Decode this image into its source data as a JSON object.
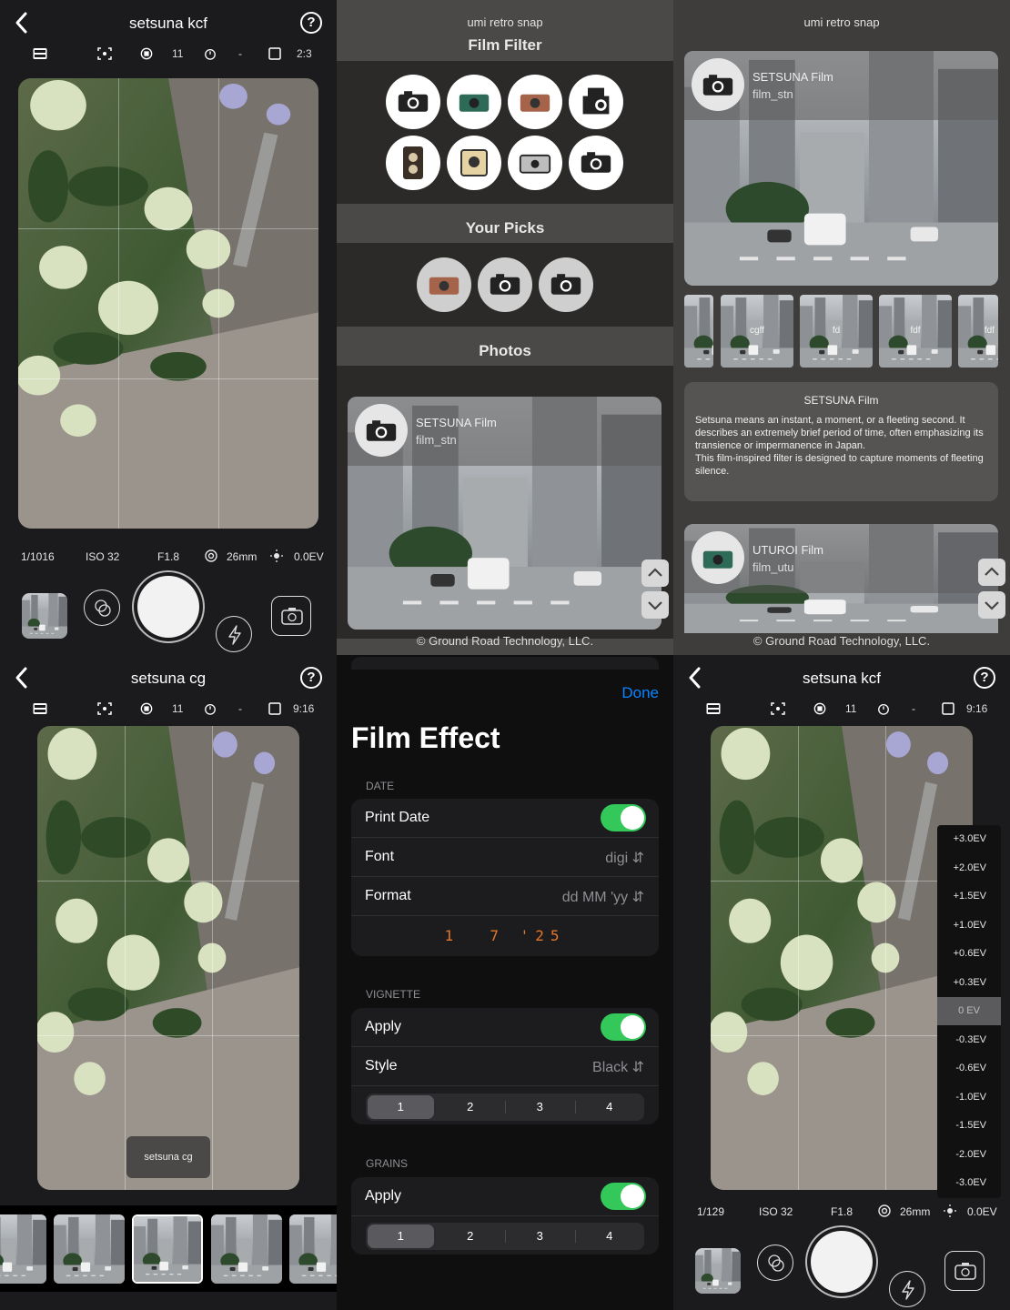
{
  "camera_kcf_1": {
    "title": "setsuna kcf",
    "toolbar": {
      "count": "11",
      "dash": "-",
      "ratio": "2:3"
    },
    "readouts": {
      "shutter": "1/1016",
      "iso": "ISO 32",
      "aperture": "F1.8",
      "focal": "26mm",
      "ev": "0.0EV"
    }
  },
  "film_filter": {
    "app_name": "umi retro snap",
    "heading": "Film Filter",
    "your_picks": "Your Picks",
    "photos": "Photos",
    "card": {
      "name": "SETSUNA Film",
      "code": "film_stn"
    },
    "footer": "Ground Road Technology, LLC."
  },
  "film_detail": {
    "app_name": "umi retro snap",
    "card": {
      "name": "SETSUNA Film",
      "code": "film_stn"
    },
    "strip_labels": [
      "",
      "cgff",
      "fd",
      "fdf",
      "fdf"
    ],
    "desc_title": "SETSUNA Film",
    "desc_body": "Setsuna means an instant, a moment, or a fleeting second. It describes an extremely brief period of time, often emphasizing its transience or impermanence in Japan.\nThis film-inspired filter is designed to capture moments of fleeting silence.",
    "card2": {
      "name": "UTUROI Film",
      "code": "film_utu"
    },
    "footer": "Ground Road Technology, LLC."
  },
  "camera_cg": {
    "title": "setsuna cg",
    "toolbar": {
      "count": "11",
      "dash": "-",
      "ratio": "9:16"
    },
    "overlay_label": "setsuna cg"
  },
  "film_effect": {
    "done": "Done",
    "heading": "Film Effect",
    "date_section": "DATE",
    "print_date": "Print Date",
    "font_label": "Font",
    "font_value": "digi",
    "format_label": "Format",
    "format_value": "dd MM 'yy",
    "date_preview": "1  7 '25",
    "vignette_section": "VIGNETTE",
    "apply": "Apply",
    "style_label": "Style",
    "style_value": "Black",
    "segments": [
      "1",
      "2",
      "3",
      "4"
    ],
    "grains_section": "GRAINS",
    "grains_apply": "Apply"
  },
  "camera_kcf_2": {
    "title": "setsuna kcf",
    "toolbar": {
      "count": "11",
      "dash": "-",
      "ratio": "9:16"
    },
    "ev_scale": [
      "+3.0EV",
      "+2.0EV",
      "+1.5EV",
      "+1.0EV",
      "+0.6EV",
      "+0.3EV",
      "0 EV",
      "-0.3EV",
      "-0.6EV",
      "-1.0EV",
      "-1.5EV",
      "-2.0EV",
      "-3.0EV"
    ],
    "readouts": {
      "shutter": "1/129",
      "iso": "ISO 32",
      "aperture": "F1.8",
      "focal": "26mm",
      "ev": "0.0EV"
    }
  }
}
